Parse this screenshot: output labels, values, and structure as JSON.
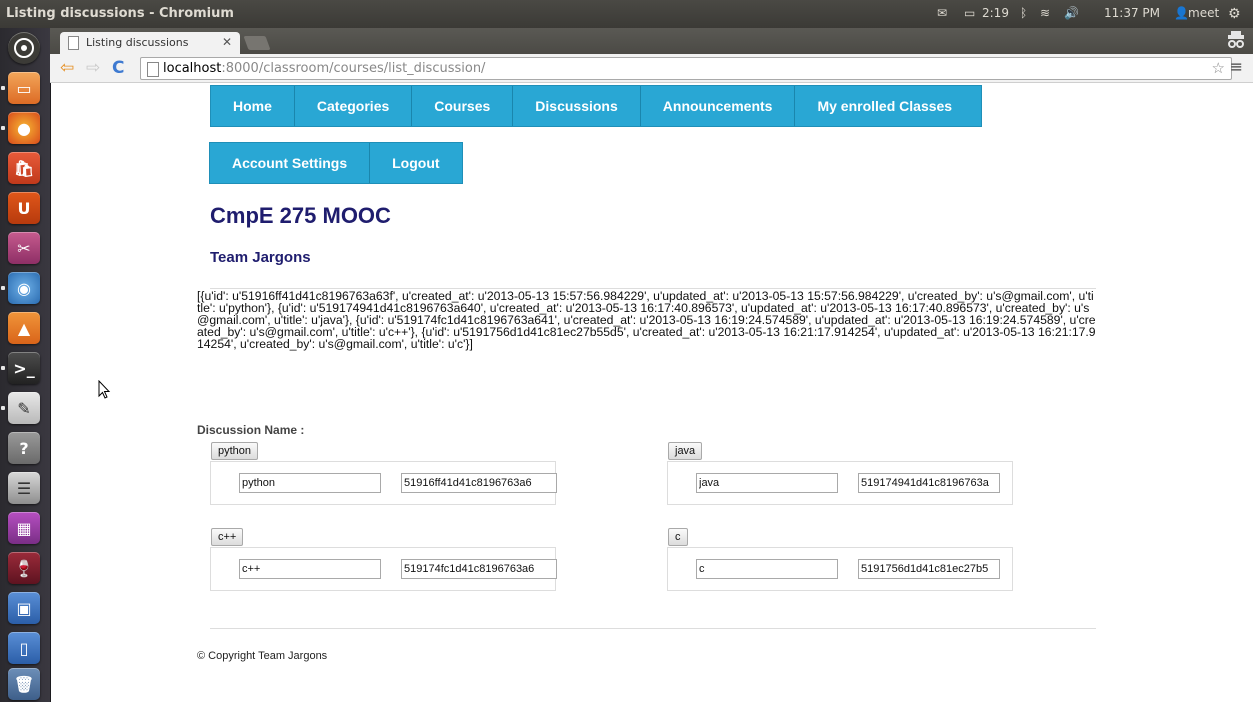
{
  "os": {
    "window_title": "Listing discussions - Chromium",
    "battery": "2:19",
    "clock": "11:37 PM",
    "user": "meet"
  },
  "browser": {
    "tab_title": "Listing discussions",
    "url_host": "localhost",
    "url_path": ":8000/classroom/courses/list_discussion/"
  },
  "nav": {
    "row1": [
      "Home",
      "Categories",
      "Courses",
      "Discussions",
      "Announcements",
      "My enrolled Classes"
    ],
    "row2": [
      "Account Settings",
      "Logout"
    ]
  },
  "header": {
    "title": "CmpE 275 MOOC",
    "subtitle": "Team Jargons"
  },
  "raw_data": "[{u'id': u'51916ff41d41c8196763a63f', u'created_at': u'2013-05-13 15:57:56.984229', u'updated_at': u'2013-05-13 15:57:56.984229', u'created_by': u's@gmail.com', u'title': u'python'}, {u'id': u'519174941d41c8196763a640', u'created_at': u'2013-05-13 16:17:40.896573', u'updated_at': u'2013-05-13 16:17:40.896573', u'created_by': u's@gmail.com', u'title': u'java'}, {u'id': u'519174fc1d41c8196763a641', u'created_at': u'2013-05-13 16:19:24.574589', u'updated_at': u'2013-05-13 16:19:24.574589', u'created_by': u's@gmail.com', u'title': u'c++'}, {u'id': u'5191756d1d41c81ec27b55d5', u'created_at': u'2013-05-13 16:21:17.914254', u'updated_at': u'2013-05-13 16:21:17.914254', u'created_by': u's@gmail.com', u'title': u'c'}]",
  "discussion": {
    "label": "Discussion Name :",
    "items": [
      {
        "button": "python",
        "name": "python",
        "id": "51916ff41d41c8196763a6"
      },
      {
        "button": "java",
        "name": "java",
        "id": "519174941d41c8196763a"
      },
      {
        "button": "c++",
        "name": "c++",
        "id": "519174fc1d41c8196763a6"
      },
      {
        "button": "c",
        "name": "c",
        "id": "5191756d1d41c81ec27b5"
      }
    ]
  },
  "footer": {
    "text": "© Copyright Team Jargons"
  }
}
